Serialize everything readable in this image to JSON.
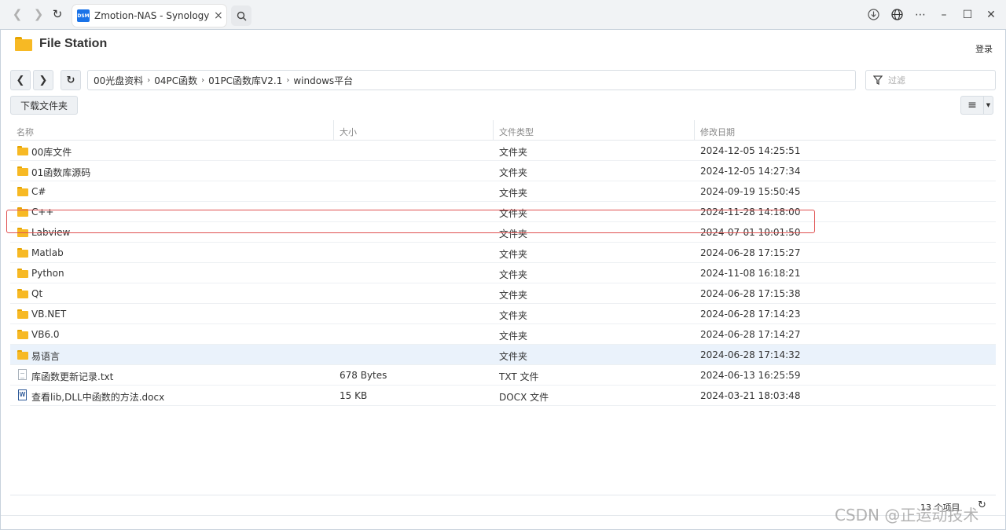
{
  "browser": {
    "tab_title": "Zmotion-NAS - Synology NAS",
    "favicon_text": "DSM"
  },
  "app": {
    "title": "File Station",
    "login_label": "登录"
  },
  "path": {
    "crumbs": [
      "00光盘资料",
      "04PC函数",
      "01PC函数库V2.1",
      "windows平台"
    ]
  },
  "filter": {
    "placeholder": "过滤"
  },
  "toolbar": {
    "download_folder_label": "下载文件夹"
  },
  "table": {
    "columns": [
      "名称",
      "大小",
      "文件类型",
      "修改日期"
    ],
    "rows": [
      {
        "name": "00库文件",
        "size": "",
        "type": "文件夹",
        "date": "2024-12-05 14:25:51",
        "icon": "folder-icon"
      },
      {
        "name": "01函数库源码",
        "size": "",
        "type": "文件夹",
        "date": "2024-12-05 14:27:34",
        "icon": "folder-icon"
      },
      {
        "name": "C#",
        "size": "",
        "type": "文件夹",
        "date": "2024-09-19 15:50:45",
        "icon": "folder-icon"
      },
      {
        "name": "C++",
        "size": "",
        "type": "文件夹",
        "date": "2024-11-28 14:18:00",
        "icon": "folder-icon"
      },
      {
        "name": "Labview",
        "size": "",
        "type": "文件夹",
        "date": "2024-07-01 10:01:50",
        "icon": "folder-icon"
      },
      {
        "name": "Matlab",
        "size": "",
        "type": "文件夹",
        "date": "2024-06-28 17:15:27",
        "icon": "folder-icon"
      },
      {
        "name": "Python",
        "size": "",
        "type": "文件夹",
        "date": "2024-11-08 16:18:21",
        "icon": "folder-icon"
      },
      {
        "name": "Qt",
        "size": "",
        "type": "文件夹",
        "date": "2024-06-28 17:15:38",
        "icon": "folder-icon"
      },
      {
        "name": "VB.NET",
        "size": "",
        "type": "文件夹",
        "date": "2024-06-28 17:14:23",
        "icon": "folder-icon"
      },
      {
        "name": "VB6.0",
        "size": "",
        "type": "文件夹",
        "date": "2024-06-28 17:14:27",
        "icon": "folder-icon"
      },
      {
        "name": "易语言",
        "size": "",
        "type": "文件夹",
        "date": "2024-06-28 17:14:32",
        "icon": "folder-icon"
      },
      {
        "name": "库函数更新记录.txt",
        "size": "678 Bytes",
        "type": "TXT 文件",
        "date": "2024-06-13 16:25:59",
        "icon": "txt-file-icon"
      },
      {
        "name": "查看lib,DLL中函数的方法.docx",
        "size": "15 KB",
        "type": "DOCX 文件",
        "date": "2024-03-21 18:03:48",
        "icon": "word-file-icon"
      }
    ]
  },
  "footer": {
    "item_count": "13 个项目"
  },
  "watermark": "CSDN @正运动技术",
  "colors": {
    "folder": "#f7b924",
    "highlight_border": "#e05050",
    "hover_row": "#eaf2fb"
  }
}
